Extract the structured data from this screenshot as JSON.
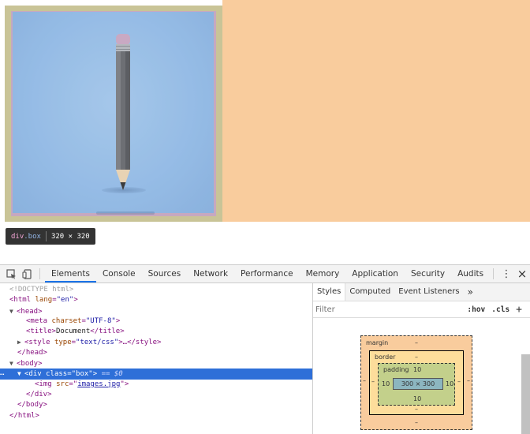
{
  "page": {
    "tooltip": {
      "tag": "div",
      "class": ".box",
      "dims": "320 × 320"
    }
  },
  "devtools": {
    "tabs": [
      "Elements",
      "Console",
      "Sources",
      "Network",
      "Performance",
      "Memory",
      "Application",
      "Security",
      "Audits"
    ],
    "active_tab": "Elements",
    "more_tabs": "»",
    "menu_icon": "⋮",
    "close_icon": "×"
  },
  "elements": {
    "doctype": "<!DOCTYPE html>",
    "html_open_tag": "<html",
    "html_lang_attr": "lang",
    "html_lang_val": "\"en\"",
    "head_open": "<head>",
    "meta_tag": "<meta",
    "meta_attr": "charset",
    "meta_val": "\"UTF-8\"",
    "title_open": "<title>",
    "title_text": "Document",
    "title_close": "</title>",
    "style_tag": "<style",
    "style_attr": "type",
    "style_val": "\"text/css\"",
    "style_rest": ">…</style>",
    "head_close": "</head>",
    "body_open": "<body>",
    "div_tag": "<div",
    "div_attr": "class",
    "div_val": "\"box\"",
    "div_end": ">",
    "div_eq": "== $0",
    "img_tag": "<img",
    "img_attr": "src",
    "img_val": "images.jpg",
    "div_close": "</div>",
    "body_close": "</body>",
    "html_close": "</html>"
  },
  "styles": {
    "tabs": [
      "Styles",
      "Computed",
      "Event Listeners"
    ],
    "more": "»",
    "filter_placeholder": "Filter",
    "hov": ":hov",
    "cls": ".cls",
    "add": "+"
  },
  "box_model": {
    "margin_label": "margin",
    "margin_top": "–",
    "margin_bottom": "–",
    "margin_left": "–",
    "margin_right": "–",
    "border_label": "border",
    "border_top": "–",
    "border_bottom": "–",
    "border_left": "–",
    "border_right": "–",
    "padding_label": "padding",
    "padding_top": "10",
    "padding_bottom": "10",
    "padding_left": "10",
    "padding_right": "10",
    "content": "300 × 300"
  },
  "colors": {
    "margin": "#f9cc9d",
    "border": "#fddd9b",
    "padding": "#c3d08b",
    "content": "#8cb6c0",
    "selection": "#2e6fd8"
  }
}
